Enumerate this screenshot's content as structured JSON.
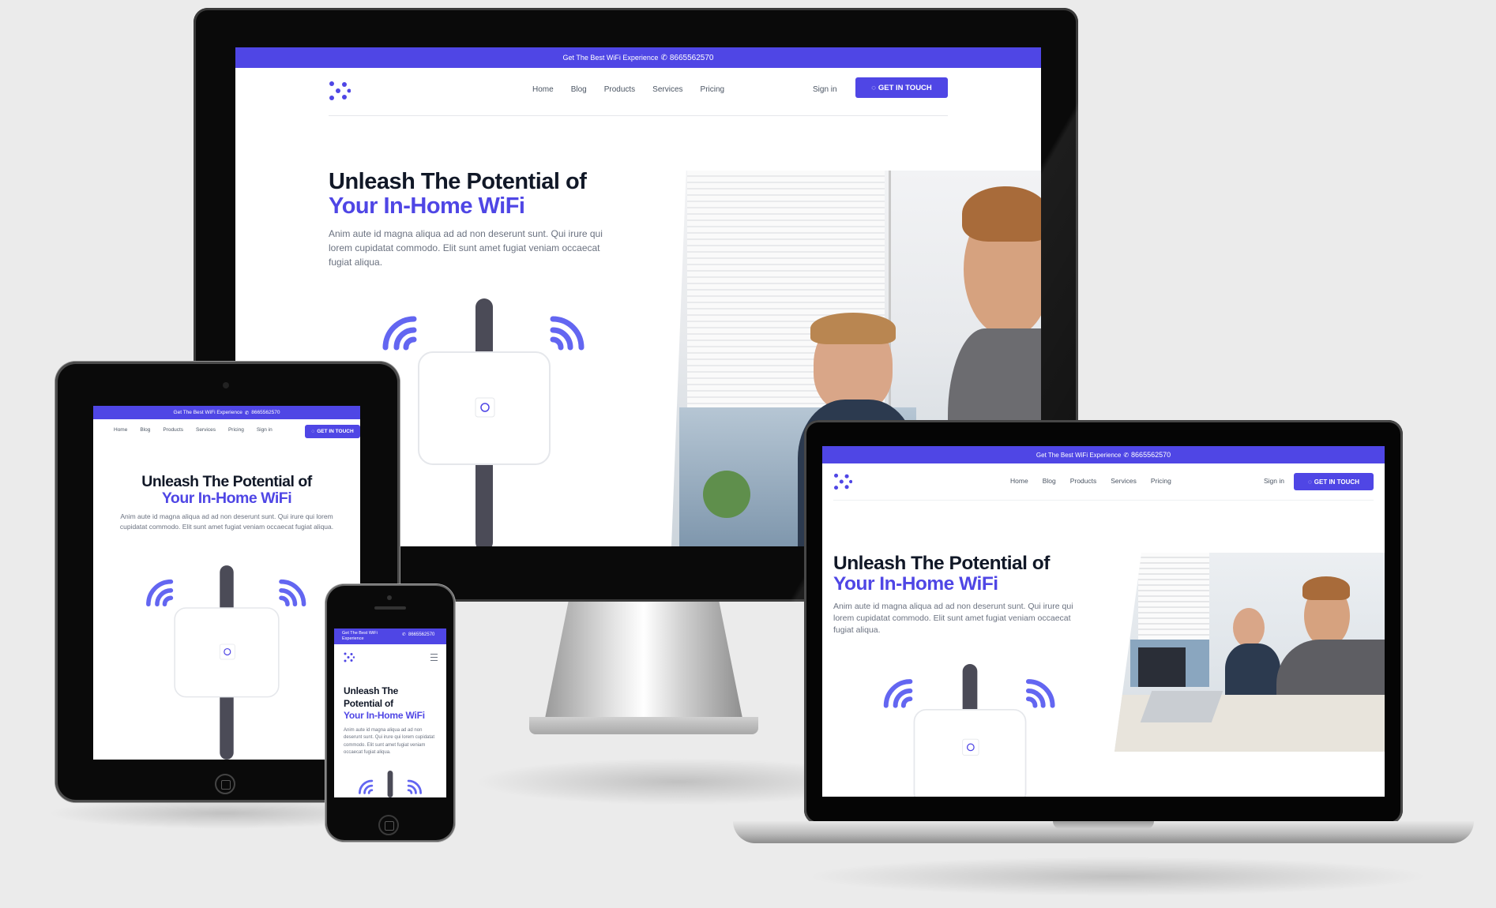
{
  "site": {
    "topbar_text": "Get The Best WiFi Experience",
    "phone": "8665562570",
    "nav": [
      "Home",
      "Blog",
      "Products",
      "Services",
      "Pricing"
    ],
    "signin": "Sign in",
    "cta": "GET IN TOUCH",
    "h1_line1": "Unleash The Potential of",
    "h1_line2": "Your In-Home WiFi",
    "h1_mobile_line1": "Unleash The",
    "h1_mobile_line2": "Potential of",
    "paragraph": "Anim aute id magna aliqua ad ad non deserunt sunt. Qui irure qui lorem cupidatat commodo. Elit sunt amet fugiat veniam occaecat fugiat aliqua."
  },
  "colors": {
    "accent": "#4f46e5",
    "heading": "#111827",
    "text": "#6b7280",
    "background": "#ebebeb"
  },
  "icons": [
    "logo-icon",
    "phone-icon",
    "chat-icon",
    "power-icon",
    "wifi-icon",
    "hamburger-icon"
  ]
}
